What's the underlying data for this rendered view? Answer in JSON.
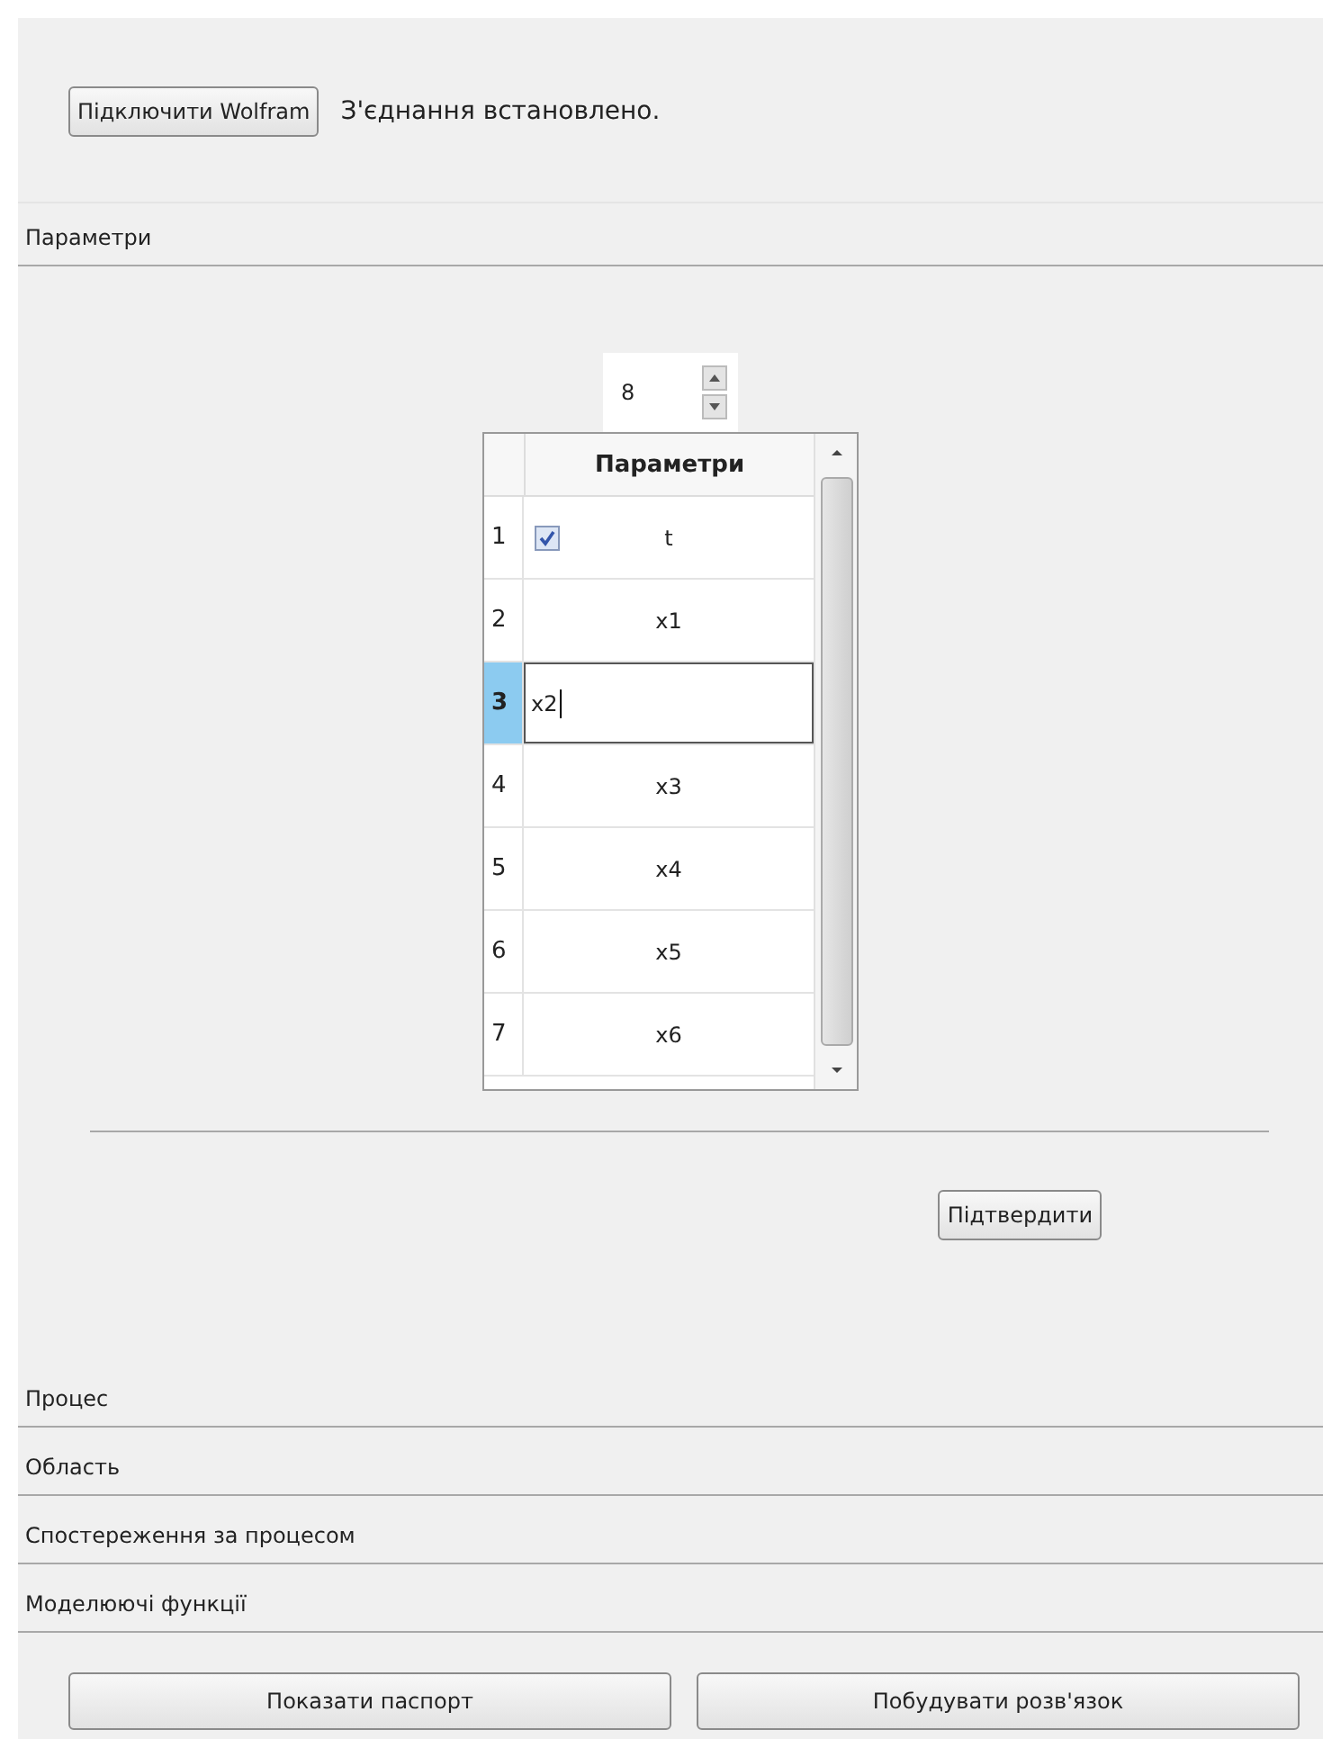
{
  "connection": {
    "button": "Підключити Wolfram",
    "status": "З'єднання встановлено."
  },
  "parameters": {
    "title": "Параметри",
    "count": "8",
    "column": "Параметри",
    "rows": [
      {
        "number": "1",
        "kind": "check",
        "checked": true,
        "value": "t",
        "selected": false
      },
      {
        "number": "2",
        "kind": "plain",
        "value": "x1",
        "selected": false
      },
      {
        "number": "3",
        "kind": "plain",
        "value": "x2",
        "selected": true
      },
      {
        "number": "4",
        "kind": "plain",
        "value": "x3",
        "selected": false
      },
      {
        "number": "5",
        "kind": "plain",
        "value": "x4",
        "selected": false
      },
      {
        "number": "6",
        "kind": "plain",
        "value": "x5",
        "selected": false
      },
      {
        "number": "7",
        "kind": "plain",
        "value": "x6",
        "selected": false
      }
    ],
    "confirm": "Підтвердити"
  },
  "sections": [
    {
      "title": "Процес"
    },
    {
      "title": "Область"
    },
    {
      "title": "Спостереження за процесом"
    },
    {
      "title": "Моделюючі функції"
    }
  ],
  "buttons": [
    "Показати паспорт",
    "Побудувати розв'язок"
  ]
}
